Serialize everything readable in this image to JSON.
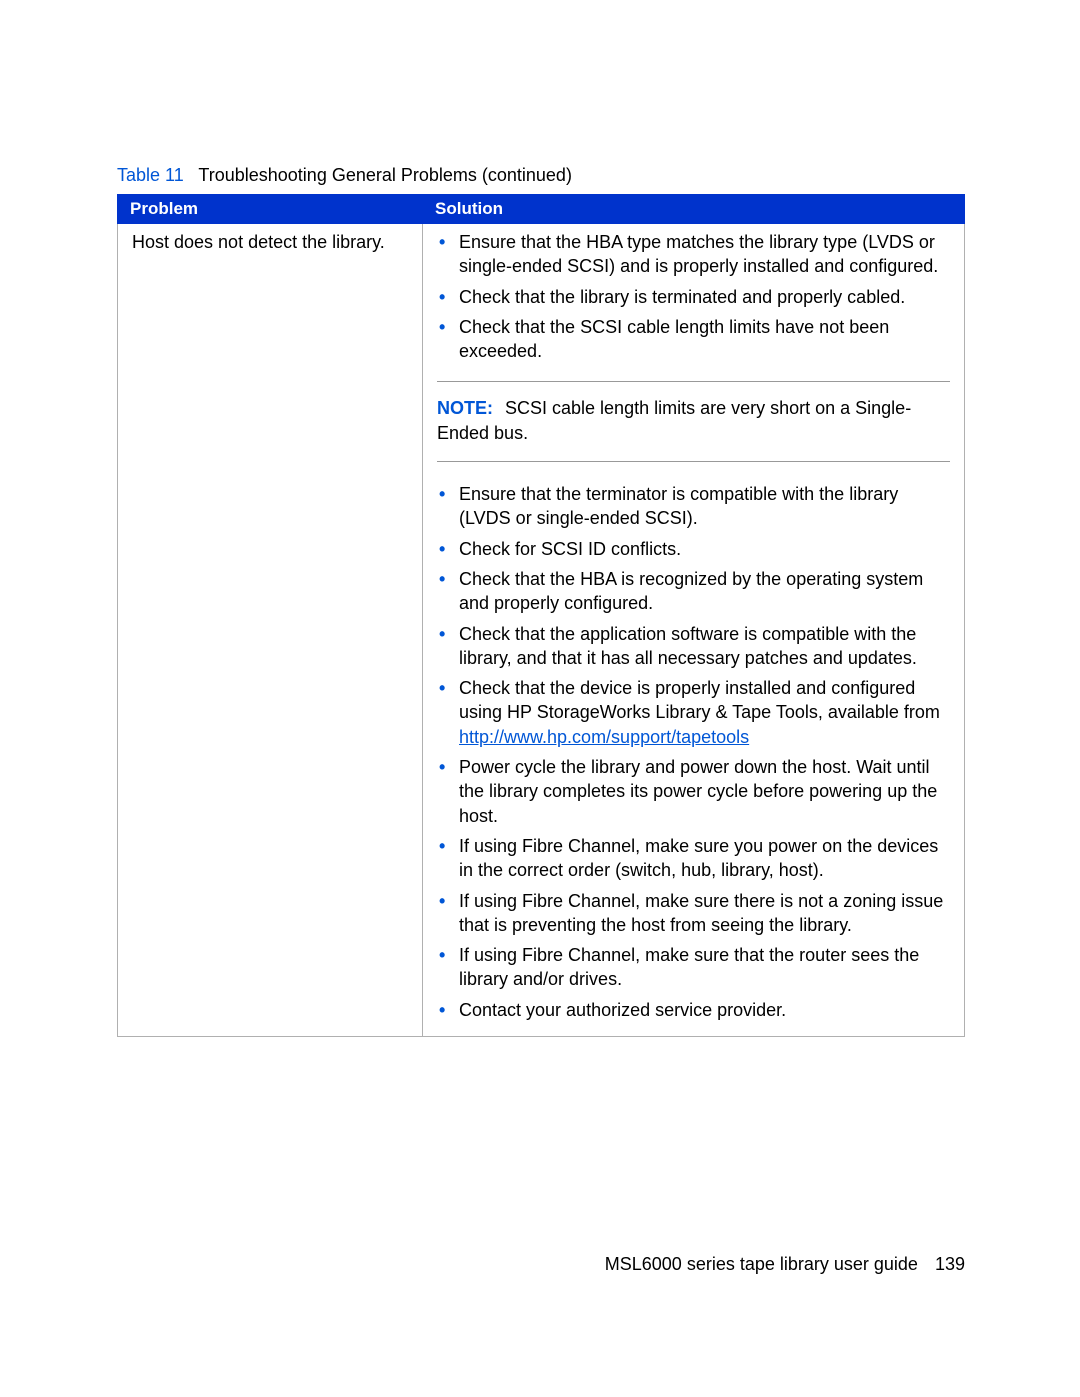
{
  "caption": {
    "num": "Table 11",
    "title": "Troubleshooting General Problems (continued)"
  },
  "headers": {
    "problem": "Problem",
    "solution": "Solution"
  },
  "row": {
    "problem": "Host does not detect the library.",
    "bullets1": [
      "Ensure that the HBA type matches the library type (LVDS or single-ended SCSI) and is properly installed and configured.",
      "Check that the library is terminated and properly cabled.",
      "Check that the SCSI cable length limits have not been exceeded."
    ],
    "note": {
      "label": "NOTE:",
      "text": "SCSI cable length limits are very short on a Single-Ended bus."
    },
    "bullets2_pre": "Check that the device is properly installed and configured using HP StorageWorks Library & Tape Tools, available from ",
    "bullets2_link": "http://www.hp.com/support/tapetools",
    "bullets2": [
      "Ensure that the terminator is compatible with the library (LVDS or single-ended SCSI).",
      "Check for SCSI ID conflicts.",
      "Check that the HBA is recognized by the operating system and properly configured.",
      "Check that the application software is compatible with the library, and that it has all necessary patches and updates."
    ],
    "bullets3": [
      "Power cycle the library and power down the host. Wait until the library completes its power cycle before powering up the host.",
      "If using Fibre Channel, make sure you power on the devices in the correct order (switch, hub, library, host).",
      "If using Fibre Channel, make sure there is not a zoning issue that is preventing the host from seeing the library.",
      "If using Fibre Channel, make sure that the router sees the library and/or drives.",
      "Contact your authorized service provider."
    ]
  },
  "footer": {
    "title": "MSL6000 series tape library user guide",
    "page": "139"
  }
}
